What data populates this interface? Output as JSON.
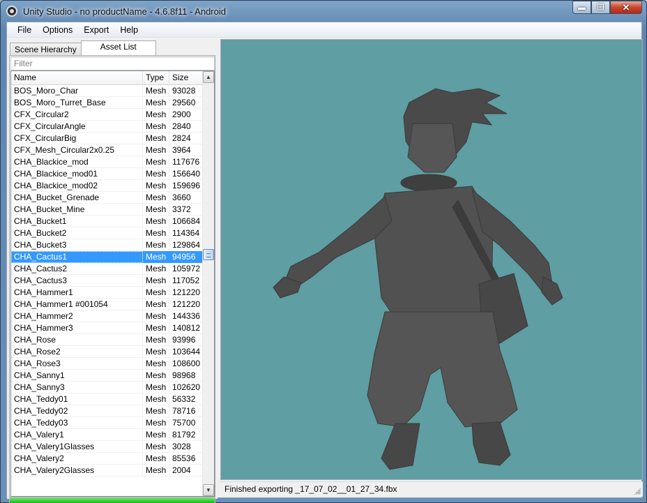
{
  "window": {
    "title": "Unity Studio - no productName - 4.6.8f11 - Android",
    "controls": {
      "minimize": "▬",
      "maximize": "❐",
      "close": "✕"
    }
  },
  "menu": [
    "File",
    "Options",
    "Export",
    "Help"
  ],
  "tabs": {
    "scene_hierarchy": "Scene Hierarchy",
    "asset_list": "Asset List"
  },
  "filter": {
    "placeholder": "Filter"
  },
  "columns": {
    "name": "Name",
    "type": "Type",
    "size": "Size"
  },
  "assets": [
    {
      "name": "BOS_Moro_Char",
      "type": "Mesh",
      "size": "93028"
    },
    {
      "name": "BOS_Moro_Turret_Base",
      "type": "Mesh",
      "size": "29560"
    },
    {
      "name": "CFX_Circular2",
      "type": "Mesh",
      "size": "2900"
    },
    {
      "name": "CFX_CircularAngle",
      "type": "Mesh",
      "size": "2840"
    },
    {
      "name": "CFX_CircularBig",
      "type": "Mesh",
      "size": "2824"
    },
    {
      "name": "CFX_Mesh_Circular2x0.25",
      "type": "Mesh",
      "size": "3964"
    },
    {
      "name": "CHA_Blackice_mod",
      "type": "Mesh",
      "size": "117676"
    },
    {
      "name": "CHA_Blackice_mod01",
      "type": "Mesh",
      "size": "156640"
    },
    {
      "name": "CHA_Blackice_mod02",
      "type": "Mesh",
      "size": "159696"
    },
    {
      "name": "CHA_Bucket_Grenade",
      "type": "Mesh",
      "size": "3660"
    },
    {
      "name": "CHA_Bucket_Mine",
      "type": "Mesh",
      "size": "3372"
    },
    {
      "name": "CHA_Bucket1",
      "type": "Mesh",
      "size": "106684"
    },
    {
      "name": "CHA_Bucket2",
      "type": "Mesh",
      "size": "114364"
    },
    {
      "name": "CHA_Bucket3",
      "type": "Mesh",
      "size": "129864"
    },
    {
      "name": "CHA_Cactus1",
      "type": "Mesh",
      "size": "94956",
      "selected": true
    },
    {
      "name": "CHA_Cactus2",
      "type": "Mesh",
      "size": "105972"
    },
    {
      "name": "CHA_Cactus3",
      "type": "Mesh",
      "size": "117052"
    },
    {
      "name": "CHA_Hammer1",
      "type": "Mesh",
      "size": "121220"
    },
    {
      "name": "CHA_Hammer1 #001054",
      "type": "Mesh",
      "size": "121220"
    },
    {
      "name": "CHA_Hammer2",
      "type": "Mesh",
      "size": "144336"
    },
    {
      "name": "CHA_Hammer3",
      "type": "Mesh",
      "size": "140812"
    },
    {
      "name": "CHA_Rose",
      "type": "Mesh",
      "size": "93996"
    },
    {
      "name": "CHA_Rose2",
      "type": "Mesh",
      "size": "103644"
    },
    {
      "name": "CHA_Rose3",
      "type": "Mesh",
      "size": "108600"
    },
    {
      "name": "CHA_Sanny1",
      "type": "Mesh",
      "size": "98968"
    },
    {
      "name": "CHA_Sanny3",
      "type": "Mesh",
      "size": "102620"
    },
    {
      "name": "CHA_Teddy01",
      "type": "Mesh",
      "size": "56332"
    },
    {
      "name": "CHA_Teddy02",
      "type": "Mesh",
      "size": "78716"
    },
    {
      "name": "CHA_Teddy03",
      "type": "Mesh",
      "size": "75700"
    },
    {
      "name": "CHA_Valery1",
      "type": "Mesh",
      "size": "81792"
    },
    {
      "name": "CHA_Valery1Glasses",
      "type": "Mesh",
      "size": "3028"
    },
    {
      "name": "CHA_Valery2",
      "type": "Mesh",
      "size": "85536"
    },
    {
      "name": "CHA_Valery2Glasses",
      "type": "Mesh",
      "size": "2004"
    }
  ],
  "scrollbar": {
    "up": "▲",
    "down": "▼"
  },
  "progress": {
    "fraction": 1.0
  },
  "status": {
    "text": "Finished exporting _17_07_02__01_27_34.fbx"
  },
  "colors": {
    "preview_background": "#5f9ea2",
    "model_fill": "#4a4a4a",
    "selection": "#3399ff",
    "progress": "#06b00a"
  }
}
